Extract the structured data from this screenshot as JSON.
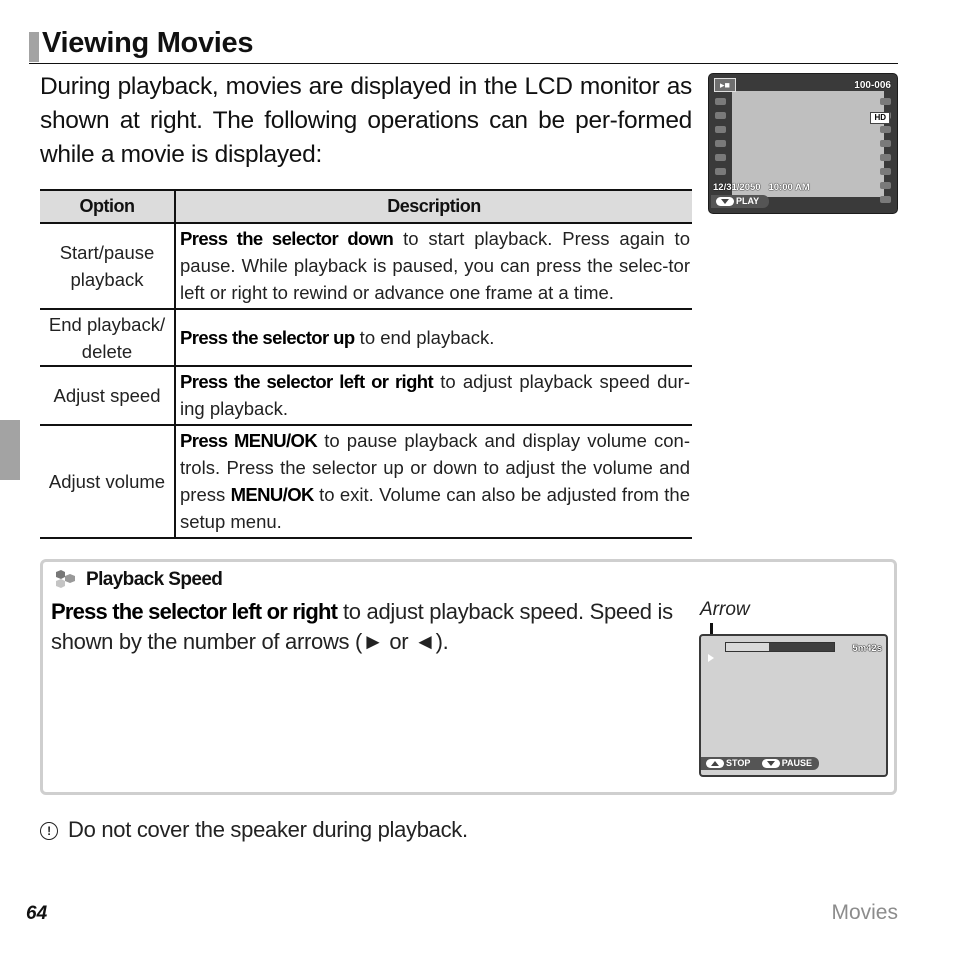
{
  "page": {
    "title": "Viewing Movies",
    "intro": "During playback, movies are displayed in the LCD monitor as shown at right.  The following operations can be per-formed while a movie is displayed:",
    "page_number": "64",
    "section": "Movies"
  },
  "lcd_playback": {
    "mode_icon": "movie-icon",
    "frame_number": "100-006",
    "quality_badge": "HD",
    "date": "12/31/2050",
    "time": "10:00 AM",
    "play_button": {
      "icon": "down-pill-icon",
      "label": "PLAY"
    }
  },
  "table": {
    "headers": {
      "option": "Option",
      "description": "Description"
    },
    "rows": [
      {
        "option_line1": "Start/pause",
        "option_line2": "playback",
        "desc_bold": "Press the selector down",
        "desc_rest": " to start playback.  Press again to pause.  While playback is paused, you can press the selec-tor left or right to rewind or advance one frame at a time."
      },
      {
        "option_line1": "End playback/",
        "option_line2": "delete",
        "desc_bold": "Press the selector up",
        "desc_rest": " to end playback."
      },
      {
        "option_line1": "Adjust speed",
        "option_line2": "",
        "desc_bold": "Press the selector left or right",
        "desc_rest": " to adjust playback speed dur-ing playback."
      },
      {
        "option_line1": "Adjust volume",
        "option_line2": "",
        "desc_bold": "Press MENU/OK",
        "desc_rest": " to pause playback and display volume con-trols.  Press the selector up or down to adjust the volume and press ",
        "desc_bold2": "MENU/OK",
        "desc_rest2": " to exit.  Volume can also be adjusted from the setup menu."
      }
    ]
  },
  "note": {
    "icon": "tip-hexagon-icon",
    "title": "Playback Speed",
    "text_bold": "Press the selector left or right",
    "text_rest": " to adjust playback speed.  Speed is shown by the number of arrows (► or ◄).",
    "callout_label": "Arrow",
    "lcd": {
      "speed_arrows": 1,
      "progress_fraction": 0.4,
      "remaining_time": "5m42s",
      "stop_button": {
        "icon": "up-pill-icon",
        "label": "STOP"
      },
      "pause_button": {
        "icon": "down-pill-icon",
        "label": "PAUSE"
      }
    }
  },
  "caution": {
    "icon": "caution-icon",
    "text": "Do not cover the speaker during playback."
  }
}
